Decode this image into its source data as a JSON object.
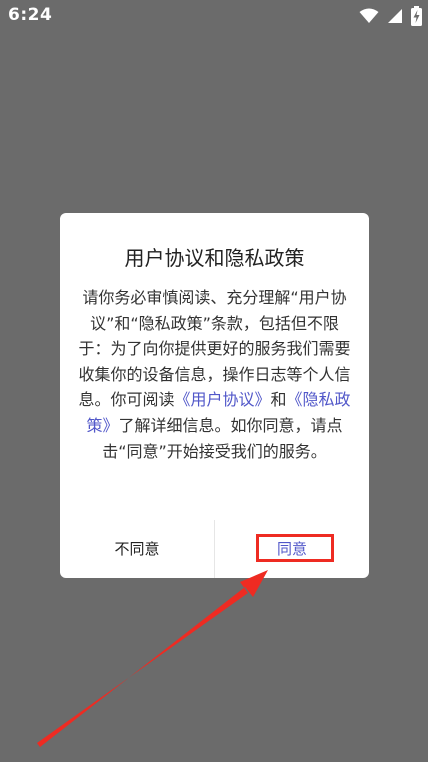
{
  "status_bar": {
    "time": "6:24",
    "icons": [
      "wifi-icon",
      "signal-icon",
      "battery-charging-icon"
    ]
  },
  "dialog": {
    "title": "用户协议和隐私政策",
    "body": {
      "intro": "请你务必审慎阅读、充分理解“用户协议”和“隐私政策”条款，包括但不限于：为了向你提供更好的服务我们需要收集你的设备信息，操作日志等个人信息。你可阅读",
      "link_user_agreement": "《用户协议》",
      "and": "和",
      "link_privacy_policy": "《隐私政策》",
      "outro": "了解详细信息。如你同意，请点击“同意”开始接受我们的服务。"
    },
    "buttons": {
      "disagree": "不同意",
      "agree": "同意"
    }
  },
  "colors": {
    "overlay": "#6b6b6b",
    "link": "#5157c9",
    "annotation_red": "#ee2b22"
  }
}
